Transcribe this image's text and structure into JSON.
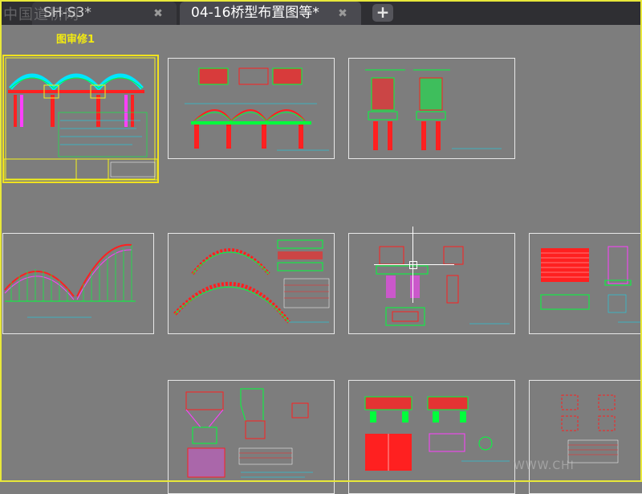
{
  "tabs": [
    {
      "label": "SH-S3*",
      "active": false
    },
    {
      "label": "04-16桥型布置图等*",
      "active": true
    }
  ],
  "tab_add_symbol": "+",
  "close_symbol": "✖",
  "watermark_text": "中国道桥网",
  "selected_sheet_title": "图审修1",
  "bottom_watermark": "WWW.CHI",
  "colors": {
    "canvas": "#7d7d7d",
    "frame": "#e8e83a",
    "cad_green": "#00ff3c",
    "cad_red": "#ff2020",
    "cad_magenta": "#ff40ff",
    "cad_cyan": "#00e5ff",
    "cad_yellow": "#f5f21a"
  }
}
